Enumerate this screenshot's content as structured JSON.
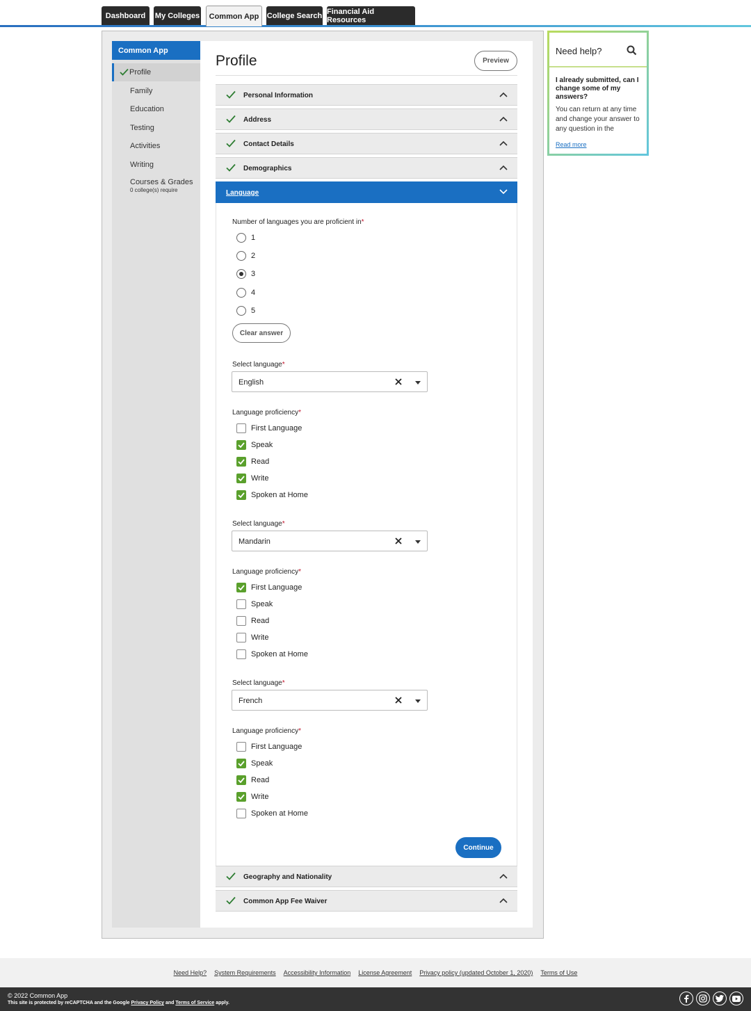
{
  "nav": {
    "tabs": [
      {
        "label": "Dashboard",
        "active": false
      },
      {
        "label": "My Colleges",
        "active": false
      },
      {
        "label": "Common App",
        "active": true
      },
      {
        "label": "College Search",
        "active": false
      },
      {
        "label": "Financial Aid Resources",
        "active": false
      }
    ]
  },
  "sidebar": {
    "header": "Common App",
    "items": [
      {
        "label": "Profile",
        "active": true
      },
      {
        "label": "Family"
      },
      {
        "label": "Education"
      },
      {
        "label": "Testing"
      },
      {
        "label": "Activities"
      },
      {
        "label": "Writing"
      },
      {
        "label": "Courses & Grades",
        "sub": "0 college(s) require"
      }
    ]
  },
  "main": {
    "title": "Profile",
    "preview_label": "Preview",
    "sections": [
      {
        "label": "Personal Information",
        "complete": true
      },
      {
        "label": "Address",
        "complete": true
      },
      {
        "label": "Contact Details",
        "complete": true
      },
      {
        "label": "Demographics",
        "complete": true
      },
      {
        "label": "Language",
        "open": true
      },
      {
        "label": "Geography and Nationality",
        "complete": true
      },
      {
        "label": "Common App Fee Waiver",
        "complete": true
      }
    ],
    "language": {
      "count_label": "Number of languages you are proficient in",
      "required_mark": "*",
      "count_options": [
        "1",
        "2",
        "3",
        "4",
        "5"
      ],
      "count_selected": "3",
      "clear_label": "Clear answer",
      "select_label": "Select language",
      "proficiency_label": "Language proficiency",
      "proficiency_options": [
        "First Language",
        "Speak",
        "Read",
        "Write",
        "Spoken at Home"
      ],
      "entries": [
        {
          "language": "English",
          "checked": [
            false,
            true,
            true,
            true,
            true
          ]
        },
        {
          "language": "Mandarin",
          "checked": [
            true,
            false,
            false,
            false,
            false
          ]
        },
        {
          "language": "French",
          "checked": [
            false,
            true,
            true,
            true,
            false
          ]
        }
      ],
      "continue_label": "Continue"
    }
  },
  "help": {
    "title": "Need help?",
    "question": "I already submitted, can I change some of my answers?",
    "answer": "You can return at any time and change your answer to any question in the Common App tab for future",
    "read_more": "Read more"
  },
  "footer": {
    "links": [
      "Need Help?",
      "System Requirements",
      "Accessibility Information",
      "License Agreement",
      "Privacy policy (updated October 1, 2020)",
      "Terms of Use"
    ],
    "copyright": "© 2022 Common App",
    "recaptcha_prefix": "This site is protected by reCAPTCHA and the Google",
    "privacy_policy": "Privacy Policy",
    "and": "and",
    "terms_of_service": "Terms of Service",
    "apply": "apply."
  },
  "colors": {
    "brand_blue": "#1a6fc2",
    "check_green": "#5aa02c",
    "required_red": "#c0142b",
    "dark_nav": "#2b2b2b"
  }
}
